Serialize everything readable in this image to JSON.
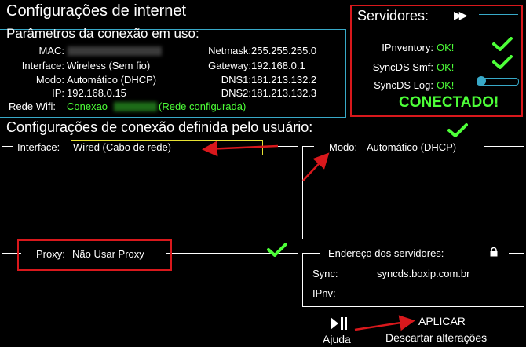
{
  "header": {
    "title": "Configurações de internet",
    "subtitle": "Parâmetros da conexão em uso:"
  },
  "connection": {
    "mac_label": "MAC:",
    "mac_value": "",
    "interface_label": "Interface:",
    "interface_value": "Wireless (Sem fio)",
    "modo_label": "Modo:",
    "modo_value": "Automático (DHCP)",
    "ip_label": "IP:",
    "ip_value": "192.168.0.15",
    "wifi_label": "Rede Wifi:",
    "wifi_prefix": "Conexao",
    "wifi_suffix": "(Rede configurada)",
    "netmask_label": "Netmask:",
    "netmask_value": "255.255.255.0",
    "gateway_label": "Gateway:",
    "gateway_value": "192.168.0.1",
    "dns1_label": "DNS1:",
    "dns1_value": "181.213.132.2",
    "dns2_label": "DNS2:",
    "dns2_value": "181.213.132.3"
  },
  "servers": {
    "title": "Servidores:",
    "items": [
      {
        "label": "IPnventory:",
        "status": "OK!"
      },
      {
        "label": "SyncDS Smf:",
        "status": "OK!"
      },
      {
        "label": "SyncDS Log:",
        "status": "OK!"
      }
    ],
    "connected": "CONECTADO!"
  },
  "user_config": {
    "title": "Configurações de conexão definida pelo usuário:",
    "interface_label": "Interface:",
    "interface_value": "Wired (Cabo de rede)",
    "modo_label": "Modo:",
    "modo_value": "Automático (DHCP)",
    "proxy_label": "Proxy:",
    "proxy_value": "Não Usar Proxy",
    "servers_title": "Endereço dos servidores:",
    "sync_label": "Sync:",
    "sync_value": "syncds.boxip.com.br",
    "ipnv_label": "IPnv:",
    "ipnv_value": ""
  },
  "actions": {
    "help_label": "Ajuda",
    "apply_label": "APLICAR",
    "discard_label": "Descartar alterações"
  },
  "colors": {
    "ok_green": "#4dff38",
    "accent_cyan": "#38a9c8",
    "annotation_red": "#d9181c",
    "highlight_yellow": "#e8e233"
  }
}
